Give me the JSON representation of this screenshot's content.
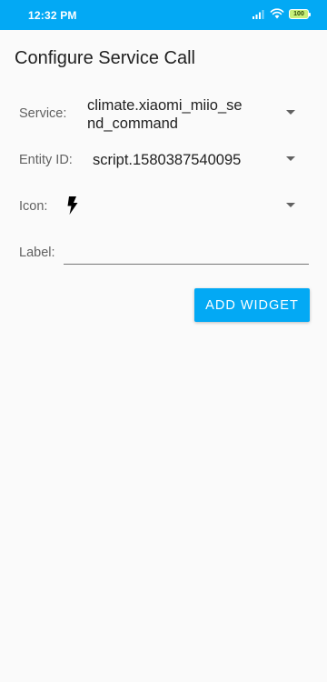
{
  "status_bar": {
    "time": "12:32 PM",
    "battery_level": "100",
    "icons": [
      "signal-icon",
      "wifi-icon",
      "battery-icon"
    ]
  },
  "title": "Configure Service Call",
  "form": {
    "service": {
      "label": "Service:",
      "value_line1": "climate.xiaomi_miio_se",
      "value_line2": "nd_command"
    },
    "entity": {
      "label": "Entity ID:",
      "value": "script.1580387540095"
    },
    "icon": {
      "label": "Icon:",
      "value_icon": "flash-icon"
    },
    "label_field": {
      "label": "Label:",
      "value": "",
      "placeholder": ""
    }
  },
  "add_button": "ADD WIDGET",
  "colors": {
    "accent": "#03a9f4",
    "background": "#fafafa",
    "text_primary": "#212121",
    "text_secondary": "#616161"
  }
}
